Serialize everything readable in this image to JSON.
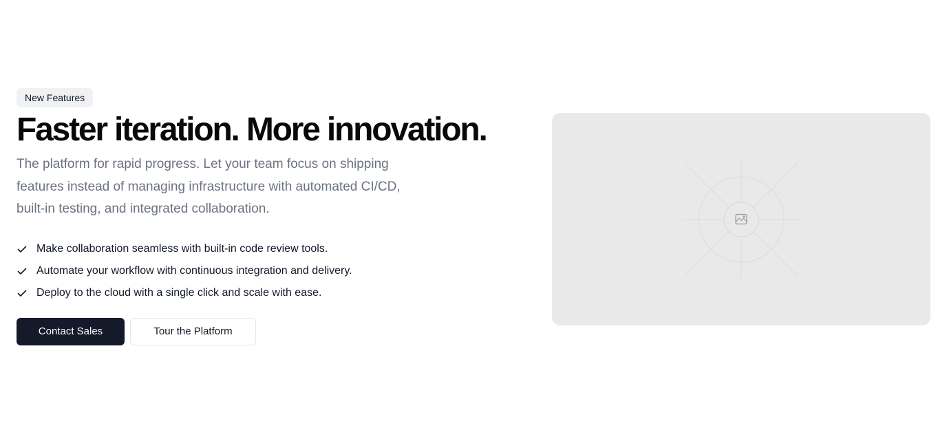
{
  "hero": {
    "badge": "New Features",
    "headline": "Faster iteration. More innovation.",
    "subtitle": "The platform for rapid progress. Let your team focus on shipping features instead of managing infrastructure with automated CI/CD, built-in testing, and integrated collaboration.",
    "features": [
      "Make collaboration seamless with built-in code review tools.",
      "Automate your workflow with continuous integration and delivery.",
      "Deploy to the cloud with a single click and scale with ease."
    ],
    "primary_button": "Contact Sales",
    "secondary_button": "Tour the Platform"
  },
  "media": {
    "icon": "image-placeholder-icon",
    "background_color": "#e9e9e9"
  },
  "colors": {
    "primary_button_bg": "#141a29",
    "muted_text": "#6b7280",
    "badge_bg": "#f0f1f3"
  }
}
